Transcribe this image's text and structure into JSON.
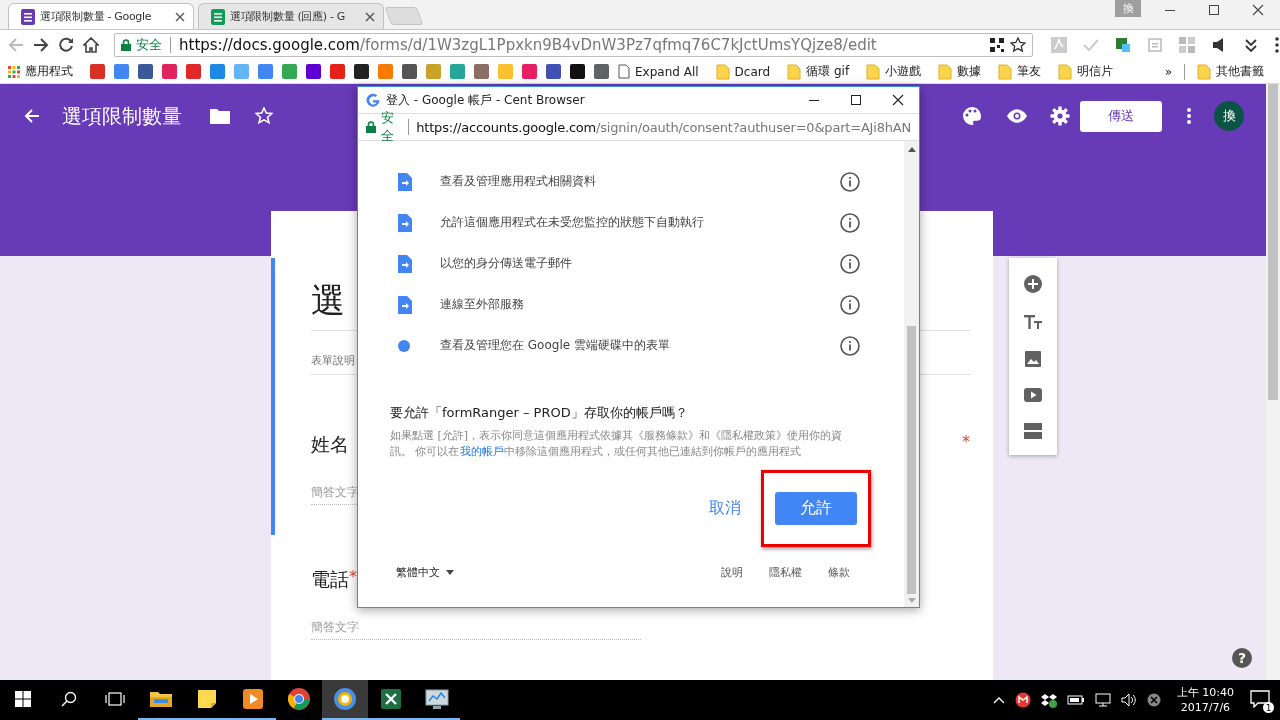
{
  "tabs": [
    {
      "title": "選項限制數量 - Google",
      "selected": true,
      "color": "#673ab7"
    },
    {
      "title": "選項限制數量 (回應) - G",
      "selected": false,
      "color": "#0f9d58"
    }
  ],
  "profile_badge": "換",
  "toolbar": {
    "back_disabled": true,
    "secure_label": "安全",
    "url_host": "https://docs.google.com",
    "url_path": "/forms/d/1W3zgL1Ppxkn9B4vDnW3Pz7qfmq76C7kJctUmsYQjze8/edit"
  },
  "bookmarks": {
    "apps_label": "應用程式",
    "favicons": [
      {
        "color": "#d93025"
      },
      {
        "color": "#4285f4"
      },
      {
        "color": "#3b5998"
      },
      {
        "color": "#e0245e"
      },
      {
        "color": "#e12828"
      },
      {
        "color": "#1e88e5"
      },
      {
        "color": "#64b5f6"
      },
      {
        "color": "#4285f4"
      },
      {
        "color": "#34a853"
      },
      {
        "color": "#5f01d1"
      },
      {
        "color": "#e62117"
      },
      {
        "color": "#222222"
      },
      {
        "color": "#f57c00"
      },
      {
        "color": "#555555"
      },
      {
        "color": "#c9a227"
      },
      {
        "color": "#26a69a"
      },
      {
        "color": "#8d6e63"
      },
      {
        "color": "#fbc02d"
      },
      {
        "color": "#e91e63"
      },
      {
        "color": "#3f51b5"
      },
      {
        "color": "#111111"
      },
      {
        "color": "#5f6368"
      }
    ],
    "items": [
      {
        "kind": "page",
        "label": "Expand All"
      },
      {
        "kind": "folder",
        "label": "Dcard"
      },
      {
        "kind": "folder",
        "label": "循環 gif"
      },
      {
        "kind": "folder",
        "label": "小遊戲"
      },
      {
        "kind": "folder",
        "label": "數據"
      },
      {
        "kind": "folder",
        "label": "筆友"
      },
      {
        "kind": "folder",
        "label": "明信片"
      }
    ],
    "more": "»",
    "other": "其他書籤"
  },
  "form_header": {
    "title": "選項限制數量",
    "send": "傳送",
    "avatar": "換"
  },
  "form": {
    "title": "選",
    "title_selected": true,
    "description": "表單說明",
    "questions": [
      {
        "title": "姓名",
        "mark": "*",
        "hint": "簡答文字",
        "selected": true
      },
      {
        "title": "電話",
        "mark": "*",
        "hint": "簡答文字",
        "selected": false
      }
    ]
  },
  "help": "?",
  "popup": {
    "title": "登入 - Google 帳戶 - Cent Browser",
    "secure_label": "安全",
    "url_host": "https://accounts.google.com",
    "url_path": "/signin/oauth/consent?authuser=0&part=AJi8hAN",
    "scopes": [
      {
        "kind": "doc",
        "text": "查看及管理應用程式相關資料"
      },
      {
        "kind": "doc",
        "text": "允許這個應用程式在未受您監控的狀態下自動執行"
      },
      {
        "kind": "doc",
        "text": "以您的身分傳送電子郵件"
      },
      {
        "kind": "doc",
        "text": "連線至外部服務"
      },
      {
        "kind": "dot",
        "text": "查看及管理您在 Google 雲端硬碟中的表單"
      }
    ],
    "question": "要允許「formRanger – PROD」存取你的帳戶嗎？",
    "notice_before": "如果點選 [允許]，表示你同意這個應用程式依據其《服務條款》和《隱私權政策》使用你的資訊。 你可以在",
    "notice_link": "我的帳戶",
    "notice_after": "中移除這個應用程式，或任何其他已連結到你帳戶的應用程式",
    "cancel": "取消",
    "allow": "允許",
    "allow_highlighted": true,
    "language": "繁體中文",
    "footer_links": [
      "說明",
      "隱私權",
      "條款"
    ]
  },
  "taskbar": {
    "apps": [
      {
        "kind": "explorer",
        "running": true,
        "selected": false
      },
      {
        "kind": "notes",
        "running": true,
        "selected": false
      },
      {
        "kind": "media",
        "running": true,
        "selected": false
      },
      {
        "kind": "chrome",
        "running": false,
        "selected": false
      },
      {
        "kind": "cent",
        "running": true,
        "selected": true
      },
      {
        "kind": "excel",
        "running": true,
        "selected": false
      },
      {
        "kind": "monitor",
        "running": true,
        "selected": false
      }
    ],
    "time": "上午 10:40",
    "date": "2017/7/6",
    "notifications": "1"
  }
}
